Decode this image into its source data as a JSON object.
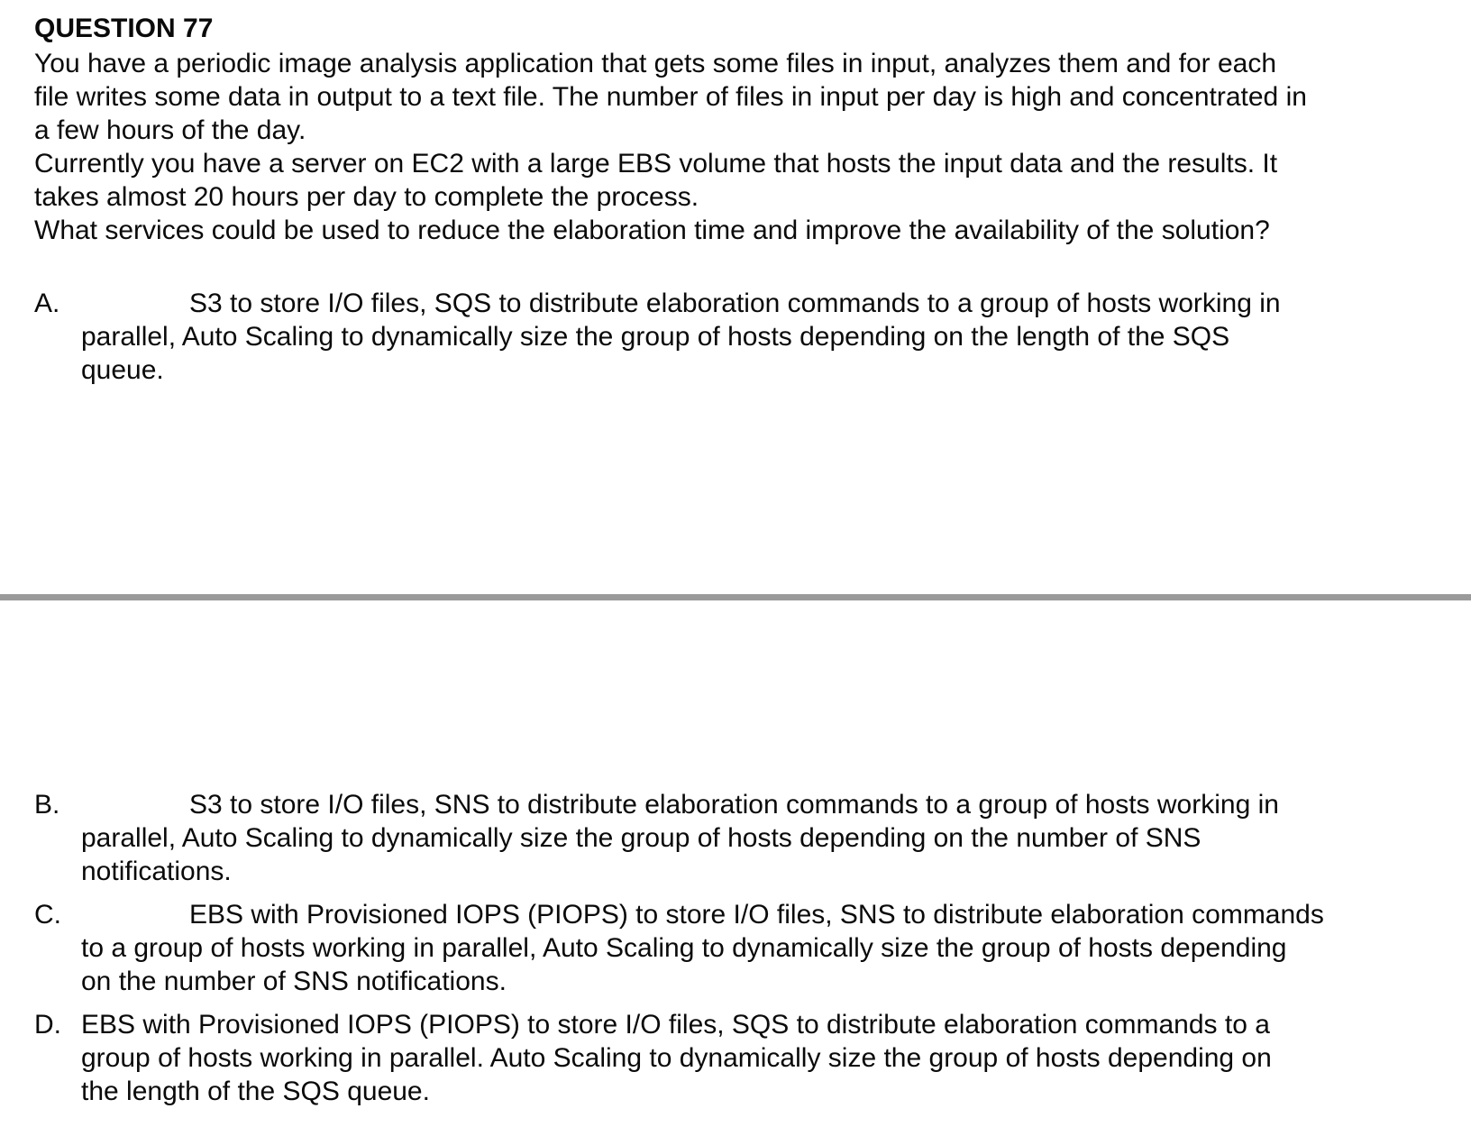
{
  "question": {
    "title": "QUESTION 77",
    "stem_lines": [
      "You have a periodic image analysis application that gets some files in input, analyzes them and for each",
      "file writes some data in output to a text file. The number of files in input per day is high and concentrated in",
      "a few hours of the day.",
      "Currently you have a server on EC2 with a large EBS volume that hosts the input data and the results. It",
      "takes almost 20 hours per day to complete the process.",
      "What services could be used to reduce the elaboration time and improve the availability of the solution?"
    ]
  },
  "options": [
    {
      "letter": "A.",
      "lines": [
        "S3 to store I/O files, SQS to distribute elaboration commands to a group of hosts working in",
        "parallel, Auto Scaling to dynamically size the group of hosts depending on the length of the SQS",
        "queue."
      ]
    },
    {
      "letter": "B.",
      "lines": [
        "S3 to store I/O files, SNS to distribute elaboration commands to a group of hosts working in",
        "parallel, Auto Scaling to dynamically size the group of hosts depending on the number of SNS",
        "notifications."
      ]
    },
    {
      "letter": "C.",
      "lines": [
        "EBS with Provisioned IOPS (PIOPS) to store I/O files, SNS to distribute elaboration commands",
        "to a group of hosts working in parallel, Auto Scaling to dynamically size the group of hosts depending",
        "on the number of SNS notifications."
      ]
    },
    {
      "letter": "D.",
      "lines": [
        "EBS with Provisioned IOPS (PIOPS) to store I/O files, SQS to distribute elaboration commands to a",
        "group of hosts working in parallel. Auto Scaling to dynamically size the group of hosts depending on",
        "the length of the SQS queue."
      ]
    }
  ]
}
